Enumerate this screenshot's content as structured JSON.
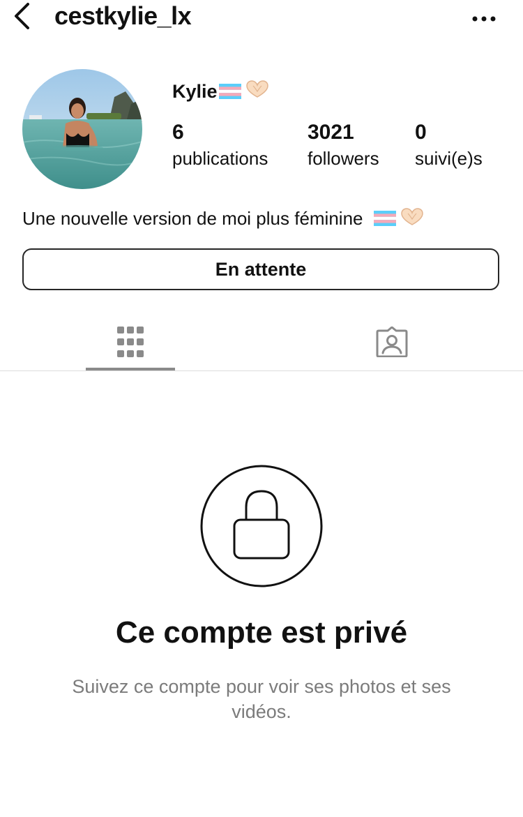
{
  "header": {
    "username": "cestkylie_lx"
  },
  "profile": {
    "display_name": "Kylie",
    "stats": [
      {
        "value": "6",
        "label": "publications"
      },
      {
        "value": "3021",
        "label": "followers"
      },
      {
        "value": "0",
        "label": "suivi(e)s"
      }
    ],
    "bio": "Une nouvelle version de moi plus féminine"
  },
  "actions": {
    "follow_status_label": "En attente"
  },
  "tabs": [
    {
      "name": "grid",
      "icon": "grid-icon",
      "active": true
    },
    {
      "name": "tagged",
      "icon": "tagged-user-icon",
      "active": false
    }
  ],
  "private_notice": {
    "title": "Ce compte est privé",
    "subtitle": "Suivez ce compte pour voir ses photos et ses vidéos."
  },
  "colors": {
    "text": "#111111",
    "muted": "#7b7b7b",
    "tab_indicator": "#8a8a8a",
    "flag_blue": "#5BCEFA",
    "flag_pink": "#F5A9B8"
  }
}
